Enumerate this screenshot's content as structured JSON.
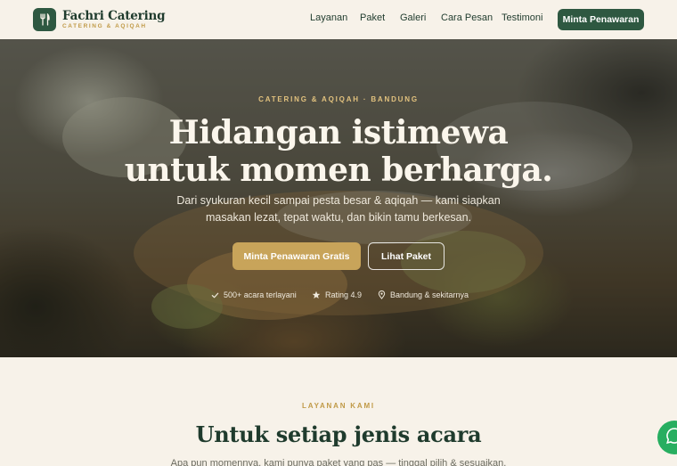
{
  "brand": {
    "name": "Fachri Catering",
    "tagline": "CATERING & AQIQAH"
  },
  "nav": {
    "items": [
      "Layanan",
      "Paket",
      "Galeri",
      "Cara Pesan",
      "Testimoni"
    ],
    "cta": "Minta Penawaran"
  },
  "hero": {
    "eyebrow": "CATERING & AQIQAH · BANDUNG",
    "title_line1": "Hidangan istimewa",
    "title_line2": "untuk momen berharga.",
    "lead_line1": "Dari syukuran kecil sampai pesta besar & aqiqah — kami siapkan",
    "lead_line2": "masakan lezat, tepat waktu, dan bikin tamu berkesan.",
    "primary_button": "Minta Penawaran Gratis",
    "secondary_button": "Lihat Paket",
    "stats": [
      {
        "icon": "check-icon",
        "text": "500+ acara terlayani"
      },
      {
        "icon": "star-icon",
        "text": "Rating 4.9"
      },
      {
        "icon": "location-pin-icon",
        "text": "Bandung & sekitarnya"
      }
    ]
  },
  "services": {
    "eyebrow": "LAYANAN KAMI",
    "title": "Untuk setiap jenis acara",
    "lead": "Apa pun momennya, kami punya paket yang pas — tinggal pilih & sesuaikan."
  },
  "colors": {
    "primary": "#2e5841",
    "accent": "#c8a45a",
    "background": "#f7f2e9",
    "whatsapp": "#27ae60"
  }
}
